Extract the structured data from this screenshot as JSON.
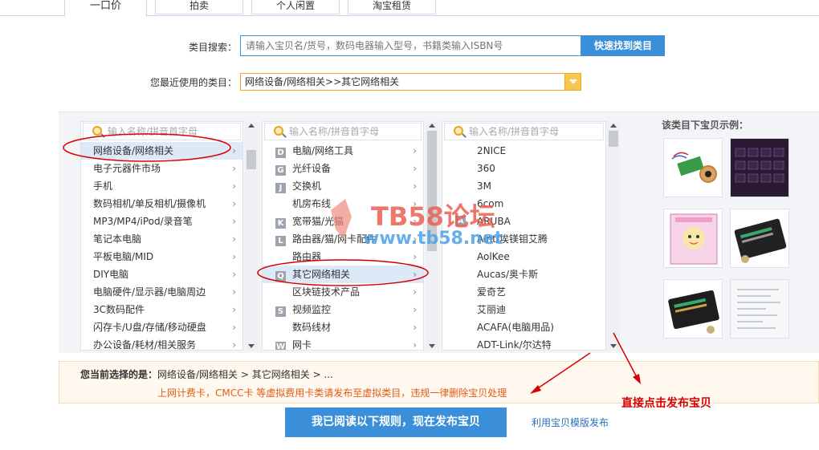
{
  "tabs": [
    {
      "label": "一口价",
      "active": true
    },
    {
      "label": "拍卖",
      "active": false
    },
    {
      "label": "个人闲置",
      "active": false
    },
    {
      "label": "淘宝租赁",
      "active": false
    }
  ],
  "search": {
    "label": "类目搜索：",
    "placeholder": "请输入宝贝名/货号，数码电器输入型号，书籍类输入ISBN号",
    "button": "快速找到类目"
  },
  "recent": {
    "label": "您最近使用的类目：",
    "value": "网络设备/网络相关>>其它网络相关"
  },
  "columns": {
    "search_placeholder": "输入名称/拼音首字母",
    "col1": [
      "网络设备/网络相关",
      "电子元器件市场",
      "手机",
      "数码相机/单反相机/摄像机",
      "MP3/MP4/iPod/录音笔",
      "笔记本电脑",
      "平板电脑/MID",
      "DIY电脑",
      "电脑硬件/显示器/电脑周边",
      "3C数码配件",
      "闪存卡/U盘/存储/移动硬盘",
      "办公设备/耗材/相关服务"
    ],
    "col2": [
      {
        "letter": "D",
        "label": "电脑/网络工具"
      },
      {
        "letter": "G",
        "label": "光纤设备"
      },
      {
        "letter": "J",
        "label": "交换机"
      },
      {
        "letter": "",
        "label": "机房布线"
      },
      {
        "letter": "K",
        "label": "宽带猫/光猫"
      },
      {
        "letter": "L",
        "label": "路由器/猫/网卡配件"
      },
      {
        "letter": "",
        "label": "路由器"
      },
      {
        "letter": "Q",
        "label": "其它网络相关"
      },
      {
        "letter": "",
        "label": "区块链技术产品"
      },
      {
        "letter": "S",
        "label": "视频监控"
      },
      {
        "letter": "",
        "label": "数码线材"
      },
      {
        "letter": "W",
        "label": "网卡"
      }
    ],
    "col3": [
      {
        "letter": "",
        "label": "2NICE"
      },
      {
        "letter": "",
        "label": "360"
      },
      {
        "letter": "",
        "label": "3M"
      },
      {
        "letter": "",
        "label": "6com"
      },
      {
        "letter": "A",
        "label": "ARUBA"
      },
      {
        "letter": "",
        "label": "Aint/埃镁钼艾腾"
      },
      {
        "letter": "",
        "label": "AolKee"
      },
      {
        "letter": "",
        "label": "Aucas/奥卡斯"
      },
      {
        "letter": "",
        "label": "爱奇艺"
      },
      {
        "letter": "",
        "label": "艾丽迪"
      },
      {
        "letter": "",
        "label": "ACAFA(电脑用品)"
      },
      {
        "letter": "",
        "label": "ADT-Link/尔达特"
      }
    ],
    "col1_selected": 0,
    "col2_selected": 7
  },
  "examples": {
    "title": "该类目下宝贝示例："
  },
  "current": {
    "prefix": "您当前选择的是：",
    "path": "网络设备/网络相关 > 其它网络相关 > ...",
    "warning": "上网计费卡，CMCC卡 等虚拟费用卡类请发布至虚拟类目，违规一律删除宝贝处理"
  },
  "actions": {
    "publish": "我已阅读以下规则，现在发布宝贝",
    "template": "利用宝贝模版发布"
  },
  "annotation": {
    "note": "直接点击发布宝贝"
  },
  "watermark": {
    "title": "TB58论坛",
    "url": "www.tb58.net"
  },
  "colors": {
    "primary": "#3b8fd9",
    "warning": "#e25c16",
    "annotation": "#d60000"
  }
}
